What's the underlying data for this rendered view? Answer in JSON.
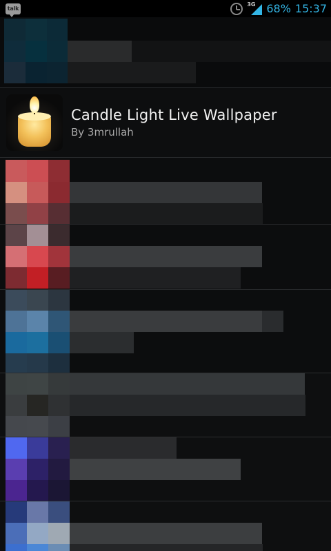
{
  "status_bar": {
    "notification_label": "talk",
    "network_type": "3G",
    "battery": "68%",
    "time": "15:37",
    "icons": [
      "talk-icon",
      "alarm-icon",
      "signal-icon"
    ],
    "accent_color": "#33b5e5"
  },
  "wallpaper_item": {
    "title": "Candle Light Live Wallpaper",
    "author": "By 3mrullah",
    "icon": "candle-icon"
  }
}
